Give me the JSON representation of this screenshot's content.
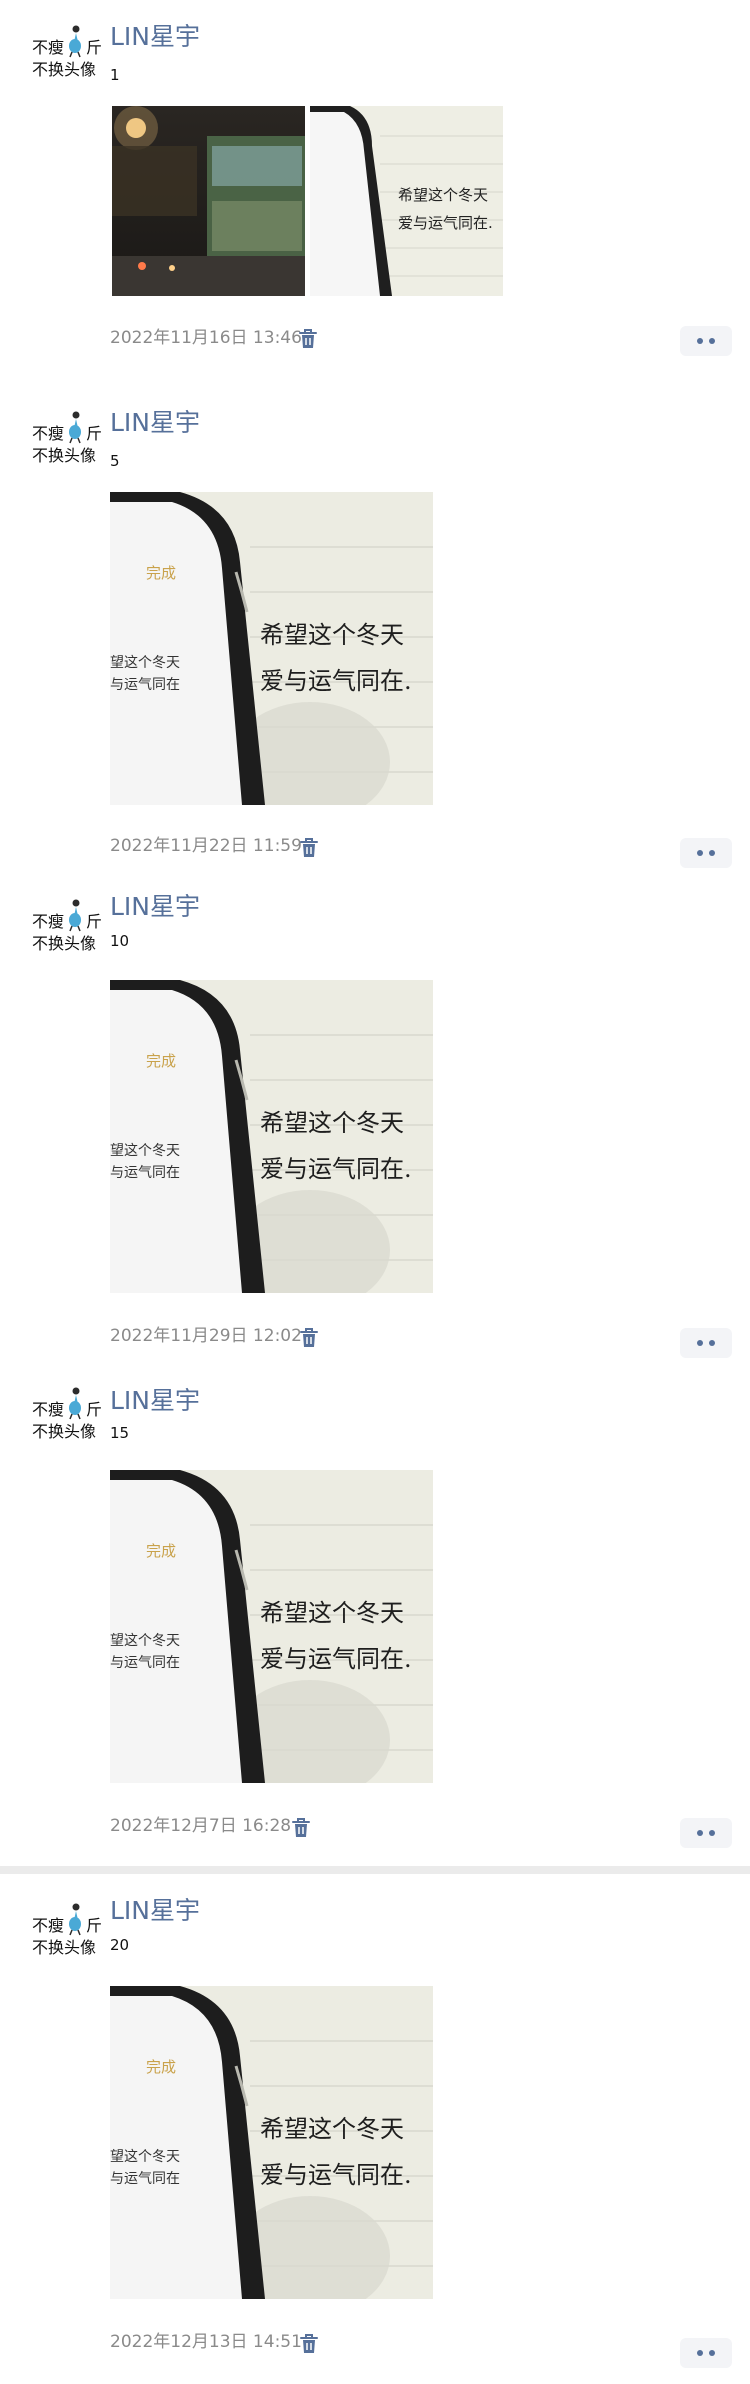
{
  "posts": [
    {
      "avatar_line1": "不瘦",
      "avatar_line1_end": "斤",
      "avatar_line2": "不换头像",
      "username": "LIN星宇",
      "text": "1",
      "timestamp": "2022年11月16日 13:46"
    },
    {
      "avatar_line1": "不瘦",
      "avatar_line1_end": "斤",
      "avatar_line2": "不换头像",
      "username": "LIN星宇",
      "text": "5",
      "timestamp": "2022年11月22日 11:59"
    },
    {
      "avatar_line1": "不瘦",
      "avatar_line1_end": "斤",
      "avatar_line2": "不换头像",
      "username": "LIN星宇",
      "text": "10",
      "timestamp": "2022年11月29日 12:02"
    },
    {
      "avatar_line1": "不瘦",
      "avatar_line1_end": "斤",
      "avatar_line2": "不换头像",
      "username": "LIN星宇",
      "text": "15",
      "timestamp": "2022年12月7日 16:28"
    },
    {
      "avatar_line1": "不瘦",
      "avatar_line1_end": "斤",
      "avatar_line2": "不换头像",
      "username": "LIN星宇",
      "text": "20",
      "timestamp": "2022年12月13日 14:51"
    }
  ],
  "photo": {
    "phone_status_done": "完成",
    "phone_line1": "望这个冬天",
    "phone_line2": "与运气同在",
    "note_line1": "希望这个冬天",
    "note_line2": "爱与运气同在."
  },
  "icons": {
    "delete": "trash-icon",
    "more": "more-dots-icon",
    "avatar_figure": "figure-icon"
  },
  "colors": {
    "username": "#56709a",
    "timestamp": "#8a8a8a",
    "divider": "#ebebeb"
  }
}
